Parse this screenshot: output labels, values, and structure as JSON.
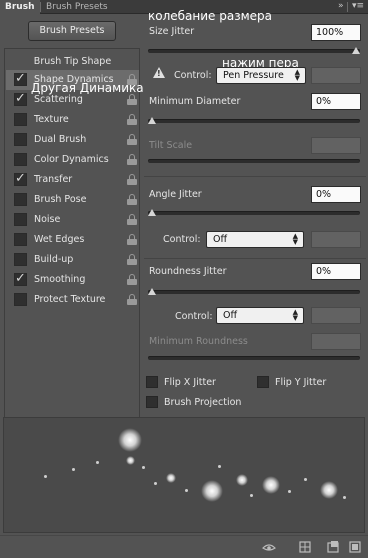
{
  "tabs": {
    "active": "Brush",
    "inactive": "Brush Presets",
    "collapse": "»",
    "menu": "▾≡"
  },
  "left": {
    "presets_button": "Brush Presets",
    "header": "Brush Tip Shape",
    "items": [
      {
        "label": "Shape Dynamics",
        "checked": true,
        "selected": true
      },
      {
        "label": "Scattering",
        "checked": true,
        "selected": false
      },
      {
        "label": "Texture",
        "checked": false,
        "selected": false
      },
      {
        "label": "Dual Brush",
        "checked": false,
        "selected": false
      },
      {
        "label": "Color Dynamics",
        "checked": false,
        "selected": false
      },
      {
        "label": "Transfer",
        "checked": true,
        "selected": false
      },
      {
        "label": "Brush Pose",
        "checked": false,
        "selected": false
      },
      {
        "label": "Noise",
        "checked": false,
        "selected": false
      },
      {
        "label": "Wet Edges",
        "checked": false,
        "selected": false
      },
      {
        "label": "Build-up",
        "checked": false,
        "selected": false
      },
      {
        "label": "Smoothing",
        "checked": true,
        "selected": false
      },
      {
        "label": "Protect Texture",
        "checked": false,
        "selected": false
      }
    ]
  },
  "annotations": {
    "size_jitter": "колебание размера",
    "control": "нажим пера",
    "shape_dynamics": "Другая Динамика"
  },
  "settings": {
    "size_jitter_label": "Size Jitter",
    "size_jitter_value": "100%",
    "size_jitter_level": 1.0,
    "control_label": "Control:",
    "size_control_value": "Pen Pressure",
    "min_diameter_label": "Minimum Diameter",
    "min_diameter_value": "0%",
    "min_diameter_level": 0.0,
    "tilt_scale_label": "Tilt Scale",
    "angle_jitter_label": "Angle Jitter",
    "angle_jitter_value": "0%",
    "angle_jitter_level": 0.0,
    "angle_control_value": "Off",
    "roundness_jitter_label": "Roundness Jitter",
    "roundness_jitter_value": "0%",
    "roundness_jitter_level": 0.0,
    "roundness_control_value": "Off",
    "min_roundness_label": "Minimum Roundness",
    "flip_x_label": "Flip X Jitter",
    "flip_y_label": "Flip Y Jitter",
    "brush_projection_label": "Brush Projection"
  },
  "icons": {
    "eye": "eye-icon",
    "grid": "grid-icon",
    "new": "new-preset-icon"
  }
}
